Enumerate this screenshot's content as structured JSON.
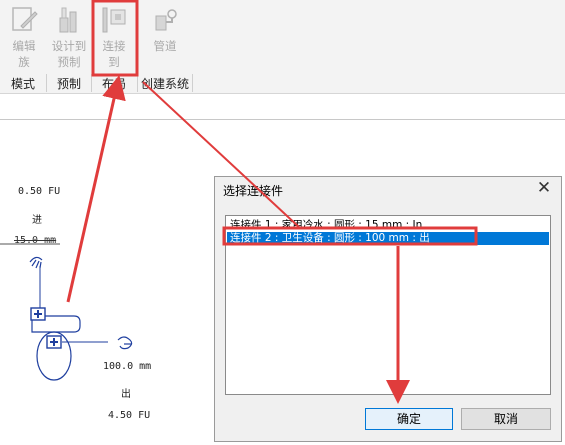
{
  "ribbon": {
    "tools": [
      {
        "label_lines": [
          "编辑",
          "族"
        ],
        "icon": "edit-family-icon"
      },
      {
        "label_lines": [
          "设计到",
          "预制"
        ],
        "icon": "design-to-fabrication-icon"
      },
      {
        "label_lines": [
          "连接",
          "到"
        ],
        "icon": "connect-into-icon"
      },
      {
        "label_lines": [
          "管道"
        ],
        "icon": "pipe-system-icon"
      }
    ],
    "panels": [
      "模式",
      "预制",
      "布局",
      "创建系统"
    ]
  },
  "drawing": {
    "label_fu_top": "0.50 FU",
    "label_in": "进",
    "label_dim": "15.0 mm",
    "label_size": "100.0 mm",
    "label_out": "出",
    "label_fu_bottom": "4.50 FU"
  },
  "dialog": {
    "title": "选择连接件",
    "close_glyph": "✕",
    "items": [
      "连接件 1 : 家用冷水 : 圆形 : 15 mm : In",
      "连接件 2 : 卫生设备 : 圆形 : 100 mm : 出"
    ],
    "selected_index": 1,
    "ok_label": "确定",
    "cancel_label": "取消"
  },
  "colors": {
    "highlight": "#e03c3c",
    "selection": "#0078d7",
    "fixture": "#1f3f9f"
  }
}
